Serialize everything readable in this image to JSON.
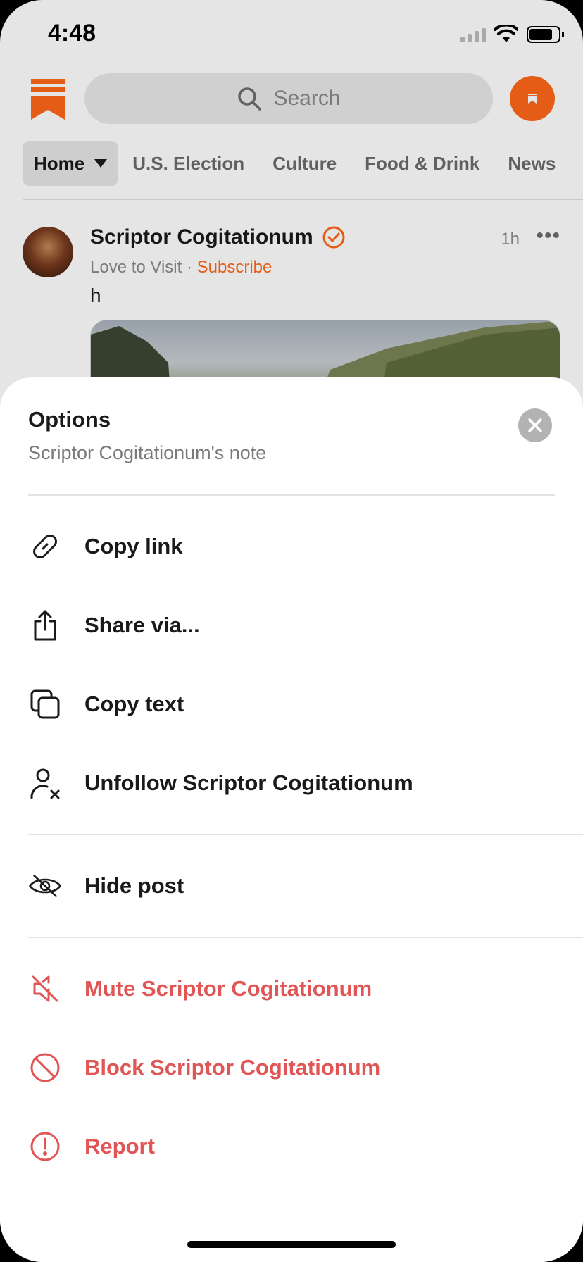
{
  "status_bar": {
    "time": "4:48"
  },
  "header": {
    "search_placeholder": "Search",
    "brand_color": "#ff6719"
  },
  "tabs": [
    {
      "label": "Home"
    },
    {
      "label": "U.S. Election"
    },
    {
      "label": "Culture"
    },
    {
      "label": "Food & Drink"
    },
    {
      "label": "News"
    }
  ],
  "post": {
    "author": "Scriptor Cogitationum",
    "time": "1h",
    "more": "•••",
    "publication": "Love to Visit",
    "separator": "·",
    "subscribe": "Subscribe",
    "text": "h"
  },
  "sheet": {
    "title": "Options",
    "subtitle": "Scriptor Cogitationum's note",
    "options": [
      {
        "label": "Copy link",
        "icon": "link-icon",
        "danger": false
      },
      {
        "label": "Share via...",
        "icon": "share-icon",
        "danger": false
      },
      {
        "label": "Copy text",
        "icon": "copy-icon",
        "danger": false
      },
      {
        "label": "Unfollow Scriptor Cogitationum",
        "icon": "unfollow-icon",
        "danger": false
      },
      {
        "label": "Hide post",
        "icon": "eye-off-icon",
        "danger": false
      },
      {
        "label": "Mute Scriptor Cogitationum",
        "icon": "mute-icon",
        "danger": true
      },
      {
        "label": "Block Scriptor Cogitationum",
        "icon": "block-icon",
        "danger": true
      },
      {
        "label": "Report",
        "icon": "report-icon",
        "danger": true
      }
    ],
    "danger_color": "#e05656"
  }
}
